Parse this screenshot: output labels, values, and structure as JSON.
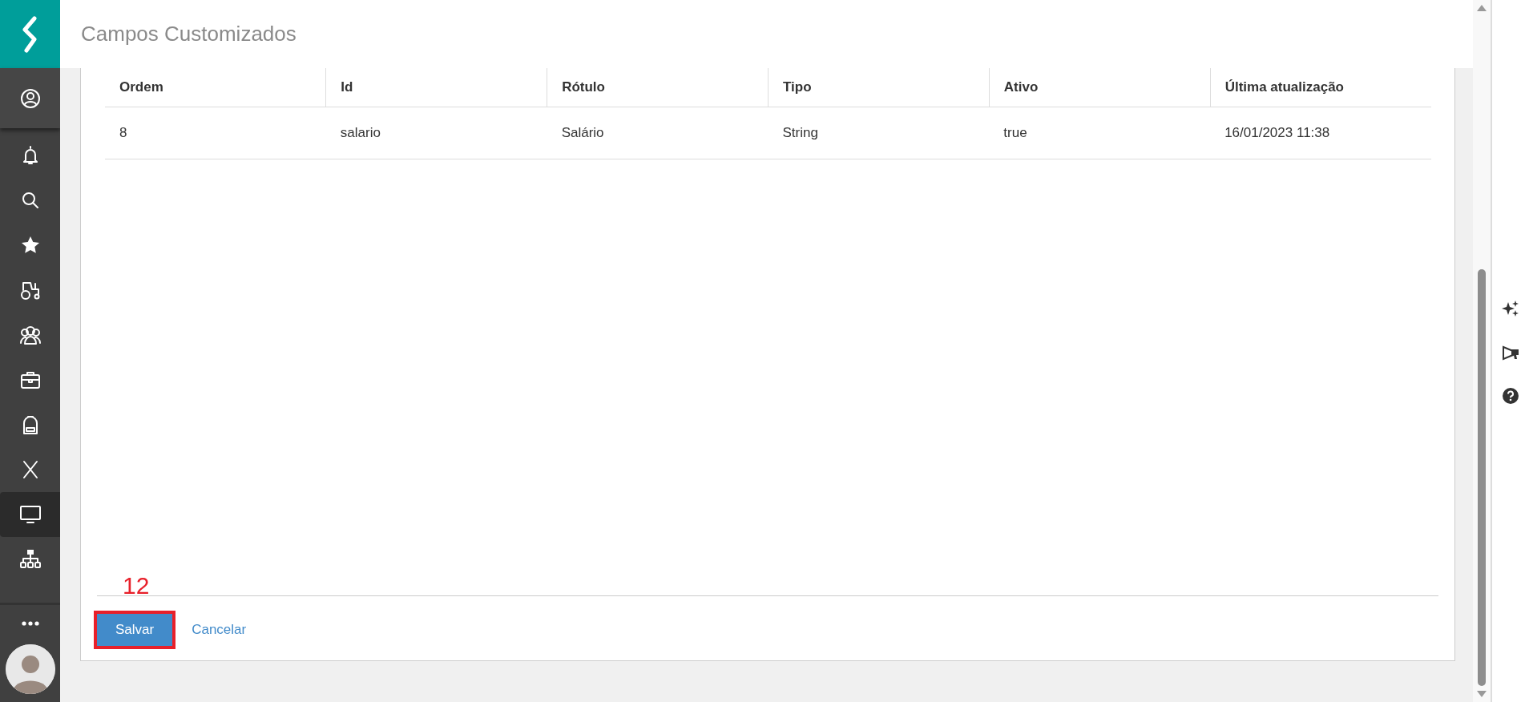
{
  "header": {
    "title": "Campos Customizados"
  },
  "sidebar": {
    "items": [
      {
        "selected": false
      },
      {
        "selected": false
      },
      {
        "selected": false
      },
      {
        "selected": false
      },
      {
        "selected": false
      },
      {
        "selected": false
      },
      {
        "selected": false
      },
      {
        "selected": false
      },
      {
        "selected": false
      },
      {
        "selected": true
      },
      {
        "selected": false
      }
    ]
  },
  "table": {
    "columns": [
      "Ordem",
      "Id",
      "Rótulo",
      "Tipo",
      "Ativo",
      "Última atualização"
    ],
    "rows": [
      [
        "8",
        "salario",
        "Salário",
        "String",
        "true",
        "16/01/2023 11:38"
      ]
    ]
  },
  "annotation": {
    "label": "12"
  },
  "buttons": [
    {
      "kind": "primary",
      "label": "Salvar"
    },
    {
      "kind": "link",
      "label": "Cancelar"
    }
  ]
}
